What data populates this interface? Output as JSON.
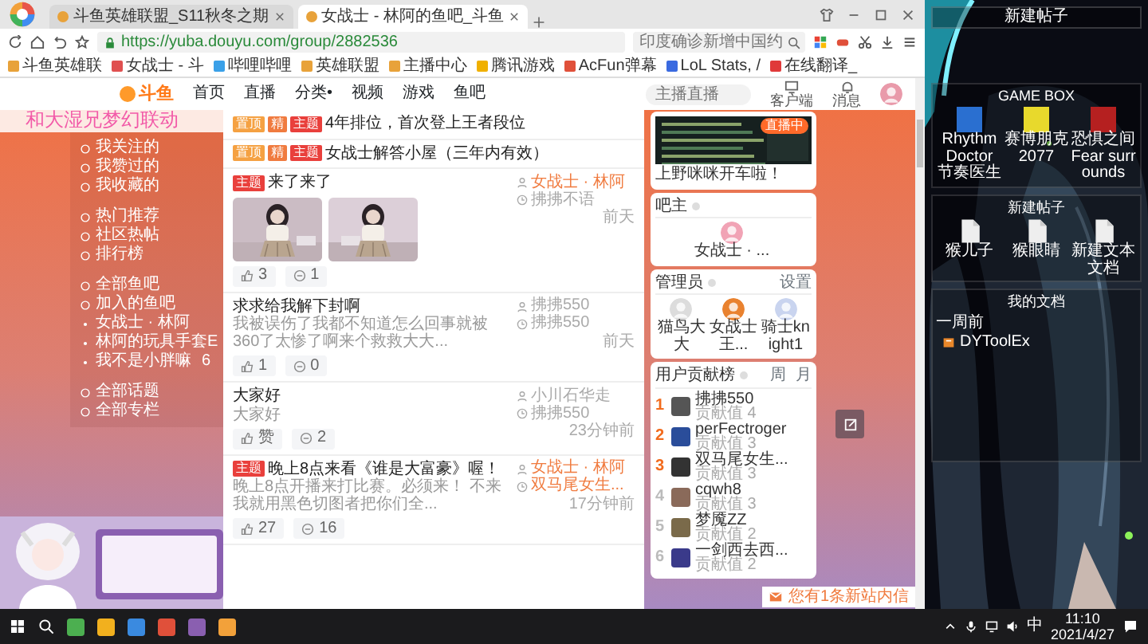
{
  "browser": {
    "tabs": [
      {
        "label": "斗鱼英雄联盟_S11秋冬之期",
        "selected": false
      },
      {
        "label": "女战士 - 林阿的鱼吧_斗鱼",
        "selected": true
      }
    ],
    "address": "https://yuba.douyu.com/group/2882536",
    "search": "印度确诊新增中国约",
    "bookmarks": [
      "斗鱼英雄联",
      "女战士 - 斗",
      "哔哩哔哩",
      "英雄联盟",
      "主播中心",
      "腾讯游戏",
      "AcFun弹幕",
      "LoL Stats, /",
      "在线翻译_"
    ]
  },
  "site": {
    "logo": "斗鱼",
    "nav": [
      "首页",
      "直播",
      "分类•",
      "视频",
      "游戏",
      "鱼吧"
    ],
    "search_placeholder": "主播直播",
    "actions": [
      {
        "label": "客户端",
        "kind": "client"
      },
      {
        "label": "消息",
        "kind": "message"
      }
    ]
  },
  "promo": "和大湿兄梦幻联动",
  "sidebar": {
    "sections": [
      {
        "items": [
          {
            "label": "我关注的",
            "kind": "link"
          },
          {
            "label": "我赞过的",
            "kind": "link"
          },
          {
            "label": "我收藏的",
            "kind": "link"
          }
        ]
      },
      {
        "items": [
          {
            "label": "热门推荐",
            "kind": "link"
          },
          {
            "label": "社区热帖",
            "kind": "link"
          },
          {
            "label": "排行榜",
            "kind": "link"
          }
        ]
      },
      {
        "items": [
          {
            "label": "全部鱼吧",
            "kind": "link"
          },
          {
            "label": "加入的鱼吧",
            "kind": "link"
          },
          {
            "label": "女战士 · 林阿",
            "kind": "bar"
          },
          {
            "label": "林阿的玩具手套E",
            "kind": "bar"
          },
          {
            "label": "我不是小胖嘛",
            "kind": "bar",
            "count": "6"
          }
        ]
      },
      {
        "items": [
          {
            "label": "全部话题",
            "kind": "link"
          },
          {
            "label": "全部专栏",
            "kind": "link"
          }
        ]
      }
    ]
  },
  "posts": [
    {
      "tags": [
        {
          "label": "置顶",
          "color": "#f5a142"
        },
        {
          "label": "精",
          "color": "#f07b3f"
        },
        {
          "label": "主题",
          "color": "#e9403c"
        }
      ],
      "title": "4年排位，首次登上王者段位"
    },
    {
      "tags": [
        {
          "label": "置顶",
          "color": "#f5a142"
        },
        {
          "label": "精",
          "color": "#f07b3f"
        },
        {
          "label": "主题",
          "color": "#e9403c"
        }
      ],
      "title": "女战士解答小屋（三年内有效）"
    },
    {
      "tags": [
        {
          "label": "主题",
          "color": "#e9403c"
        }
      ],
      "title": "来了来了",
      "author": {
        "name": "女战士 · 林阿",
        "highlight": true
      },
      "replier": {
        "name": "拂拂不语",
        "highlight": false
      },
      "time": "前天",
      "images": [
        {
          "kind": "picture"
        },
        {
          "kind": "picture"
        }
      ],
      "likes": "3",
      "comments": "1"
    },
    {
      "title": "求求给我解下封啊",
      "excerpt": "我被误伤了我都不知道怎么回事就被360了太惨了啊来个救救大大...",
      "author": {
        "name": "拂拂550",
        "highlight": false
      },
      "replier": {
        "name": "拂拂550",
        "highlight": false
      },
      "time": "前天",
      "likes": "1",
      "comments": "0"
    },
    {
      "title": "大家好",
      "excerpt": "大家好",
      "author": {
        "name": "小川石华走",
        "highlight": false
      },
      "replier": {
        "name": "拂拂550",
        "highlight": false
      },
      "time": "23分钟前",
      "likes": "赞",
      "comments": "2"
    },
    {
      "tags": [
        {
          "label": "主题",
          "color": "#e9403c"
        }
      ],
      "title": "晚上8点来看《谁是大富豪》喔！",
      "excerpt": "晚上8点开播来打比赛。必须来！ 不来我就用黑色切图者把你们全...",
      "author": {
        "name": "女战士 · 林阿",
        "highlight": true
      },
      "replier": {
        "name": "双马尾女生...",
        "highlight": true
      },
      "time": "17分钟前",
      "likes": "27",
      "comments": "16"
    }
  ],
  "right": {
    "live": {
      "badge": "直播中",
      "caption": "上野咪咪开车啦！"
    },
    "owner": {
      "title": "吧主",
      "members": [
        "女战士 · ..."
      ]
    },
    "admins": {
      "title": "管理员",
      "action": "设置",
      "members": [
        "猫鸟大大",
        "女战士王...",
        "骑士knight1"
      ]
    },
    "ranking": {
      "title": "用户贡献榜",
      "periods": [
        "周",
        "月"
      ],
      "rows": [
        {
          "rank": "1",
          "name": "拂拂550",
          "score": "贡献值 4",
          "color": "#f26b1d"
        },
        {
          "rank": "2",
          "name": "perFectroger",
          "score": "贡献值 3",
          "color": "#f26b1d"
        },
        {
          "rank": "3",
          "name": "双马尾女生...",
          "score": "贡献值 3",
          "color": "#f26b1d"
        },
        {
          "rank": "4",
          "name": "cqwh8",
          "score": "贡献值 3",
          "color": "#bbbbbb"
        },
        {
          "rank": "5",
          "name": "梦魇ZZ",
          "score": "贡献值 2",
          "color": "#bbbbbb"
        },
        {
          "rank": "6",
          "name": "一剑西去西...",
          "score": "贡献值 2",
          "color": "#bbbbbb"
        }
      ]
    }
  },
  "notice": "您有1条新站内信",
  "desktop": {
    "header": "新建帖子",
    "panels": [
      {
        "title": "GAME BOX",
        "kind": "grid",
        "items": [
          {
            "label": "Rhythm Doctor 节奏医生",
            "kind": "app",
            "color": "#2a6fd0"
          },
          {
            "label": "赛博朋克 2077",
            "kind": "app",
            "color": "#e8d92c"
          },
          {
            "label": "恐惧之间 Fear surrounds",
            "kind": "app",
            "color": "#b52020"
          }
        ]
      },
      {
        "title": "新建帖子",
        "kind": "grid",
        "items": [
          {
            "label": "猴儿子",
            "kind": "file"
          },
          {
            "label": "猴眼睛",
            "kind": "file"
          },
          {
            "label": "新建文本文档",
            "kind": "file"
          }
        ]
      },
      {
        "title": "我的文档",
        "kind": "list",
        "items": [
          {
            "label": "一周前",
            "kind": "heading"
          },
          {
            "label": "DYToolEx",
            "kind": "folder"
          }
        ]
      }
    ]
  },
  "taskbar": {
    "ime": "中",
    "time": "11:10",
    "date": "2021/4/27"
  }
}
